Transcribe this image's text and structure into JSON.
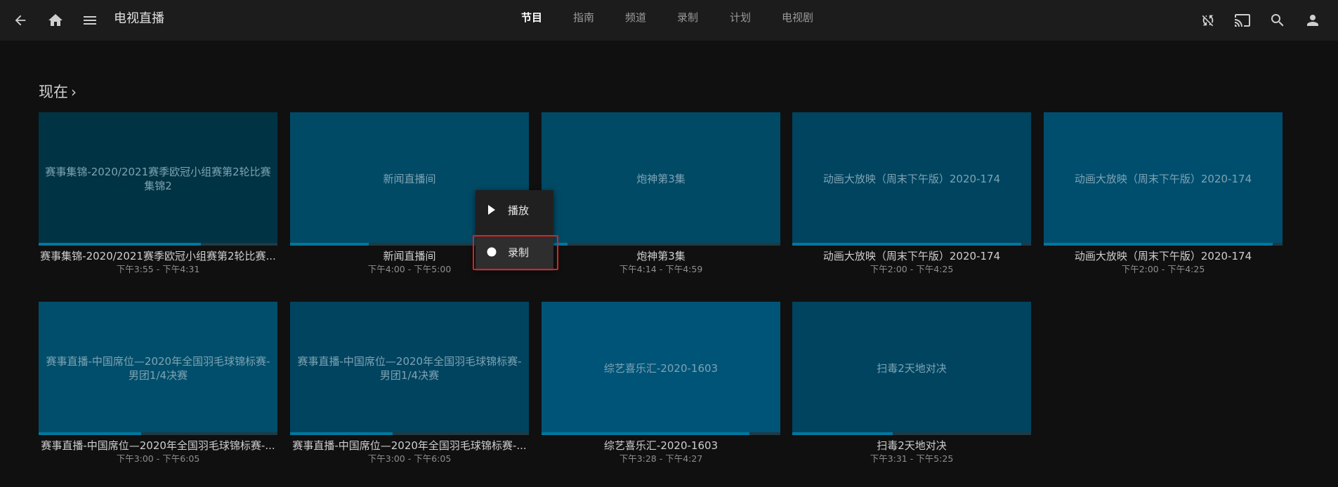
{
  "app": {
    "title": "电视直播"
  },
  "header": {
    "tabs": [
      {
        "label": "节目",
        "active": true
      },
      {
        "label": "指南",
        "active": false
      },
      {
        "label": "频道",
        "active": false
      },
      {
        "label": "录制",
        "active": false
      },
      {
        "label": "计划",
        "active": false
      },
      {
        "label": "电视剧",
        "active": false
      }
    ],
    "left_icons": [
      "back-arrow-icon",
      "home-icon",
      "menu-icon"
    ],
    "right_icons": [
      "sync-disabled-icon",
      "cast-icon",
      "search-icon",
      "user-icon"
    ]
  },
  "section": {
    "title": "现在",
    "chevron": "›"
  },
  "cards": [
    {
      "thumb_text": "赛事集锦-2020/2021赛季欧冠小组赛第2轮比赛集锦2",
      "title": "赛事集锦-2020/2021赛季欧冠小组赛第2轮比赛...",
      "time": "下午3:55 - 下午4:31",
      "progress": 0.68,
      "color": "#003344"
    },
    {
      "thumb_text": "新闻直播间",
      "title": "新闻直播间",
      "time": "下午4:00 - 下午5:00",
      "progress": 0.33,
      "color": "#004a66"
    },
    {
      "thumb_text": "炮神第3集",
      "title": "炮神第3集",
      "time": "下午4:14 - 下午4:59",
      "progress": 0.11,
      "color": "#004a66"
    },
    {
      "thumb_text": "动画大放映（周末下午版）2020-174",
      "title": "动画大放映（周末下午版）2020-174",
      "time": "下午2:00 - 下午4:25",
      "progress": 0.96,
      "color": "#004460"
    },
    {
      "thumb_text": "动画大放映（周末下午版）2020-174",
      "title": "动画大放映（周末下午版）2020-174",
      "time": "下午2:00 - 下午4:25",
      "progress": 0.96,
      "color": "#004e6e"
    },
    {
      "thumb_text": "赛事直播-中国席位—2020年全国羽毛球锦标赛-男团1/4决赛",
      "title": "赛事直播-中国席位—2020年全国羽毛球锦标赛-...",
      "time": "下午3:00 - 下午6:05",
      "progress": 0.43,
      "color": "#004e6b"
    },
    {
      "thumb_text": "赛事直播-中国席位—2020年全国羽毛球锦标赛-男团1/4决赛",
      "title": "赛事直播-中国席位—2020年全国羽毛球锦标赛-...",
      "time": "下午3:00 - 下午6:05",
      "progress": 0.43,
      "color": "#004460"
    },
    {
      "thumb_text": "综艺喜乐汇-2020-1603",
      "title": "综艺喜乐汇-2020-1603",
      "time": "下午3:28 - 下午4:27",
      "progress": 0.87,
      "color": "#005477"
    },
    {
      "thumb_text": "扫毒2天地对决",
      "title": "扫毒2天地对决",
      "time": "下午3:31 - 下午5:25",
      "progress": 0.42,
      "color": "#004460"
    }
  ],
  "context_menu": {
    "items": [
      {
        "label": "播放",
        "icon": "play-icon"
      },
      {
        "label": "录制",
        "icon": "record-icon",
        "focused": true
      }
    ]
  },
  "colors": {
    "background": "#101010",
    "topbar": "#1c1c1c",
    "accent": "#01779e",
    "highlight": "#e02020"
  }
}
